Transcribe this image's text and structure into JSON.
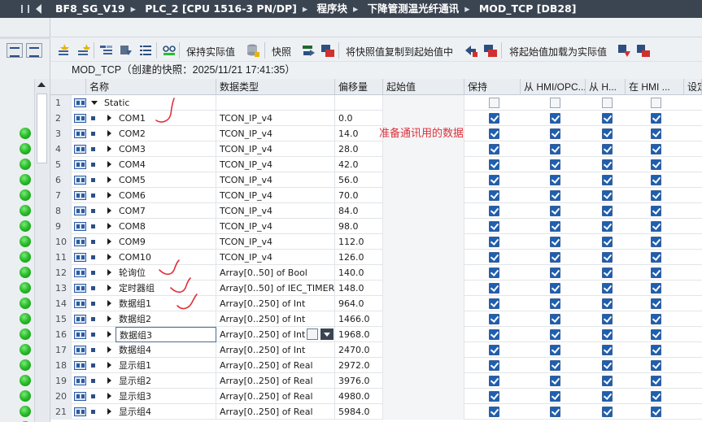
{
  "titlebar": {
    "crumbs": [
      "BF8_SG_V19",
      "PLC_2 [CPU 1516-3 PN/DP]",
      "程序块",
      "下降管测温光纤通讯",
      "MOD_TCP [DB28]"
    ],
    "separator": "▸"
  },
  "toolbar": {
    "keep_actual": "保持实际值",
    "snapshot": "快照",
    "copy_snapshot": "将快照值复制到起始值中",
    "load_start": "将起始值加载为实际值"
  },
  "snapshot_title": "MOD_TCP（创建的快照：2025/11/21 17:41:35）",
  "columns": {
    "name": "名称",
    "datatype": "数据类型",
    "offset": "偏移量",
    "start": "起始值",
    "retain": "保持",
    "from_hmi": "从 HMI/OPC...",
    "from_h": "从 H...",
    "in_hmi": "在 HMI ...",
    "setpoint": "设定"
  },
  "annotation": "准备通讯用的数据",
  "rows": [
    {
      "num": "1",
      "name": "Static",
      "type": "",
      "offset": "",
      "expanded": true
    },
    {
      "num": "2",
      "name": "COM1",
      "type": "TCON_IP_v4",
      "offset": "0.0"
    },
    {
      "num": "3",
      "name": "COM2",
      "type": "TCON_IP_v4",
      "offset": "14.0"
    },
    {
      "num": "4",
      "name": "COM3",
      "type": "TCON_IP_v4",
      "offset": "28.0"
    },
    {
      "num": "5",
      "name": "COM4",
      "type": "TCON_IP_v4",
      "offset": "42.0"
    },
    {
      "num": "6",
      "name": "COM5",
      "type": "TCON_IP_v4",
      "offset": "56.0"
    },
    {
      "num": "7",
      "name": "COM6",
      "type": "TCON_IP_v4",
      "offset": "70.0"
    },
    {
      "num": "8",
      "name": "COM7",
      "type": "TCON_IP_v4",
      "offset": "84.0"
    },
    {
      "num": "9",
      "name": "COM8",
      "type": "TCON_IP_v4",
      "offset": "98.0"
    },
    {
      "num": "10",
      "name": "COM9",
      "type": "TCON_IP_v4",
      "offset": "112.0"
    },
    {
      "num": "11",
      "name": "COM10",
      "type": "TCON_IP_v4",
      "offset": "126.0"
    },
    {
      "num": "12",
      "name": "轮询位",
      "type": "Array[0..50] of Bool",
      "offset": "140.0"
    },
    {
      "num": "13",
      "name": "定时器组",
      "type": "Array[0..50] of IEC_TIMER",
      "offset": "148.0"
    },
    {
      "num": "14",
      "name": "数据组1",
      "type": "Array[0..250] of Int",
      "offset": "964.0"
    },
    {
      "num": "15",
      "name": "数据组2",
      "type": "Array[0..250] of Int",
      "offset": "1466.0"
    },
    {
      "num": "16",
      "name": "数据组3",
      "type": "Array[0..250] of Int",
      "offset": "1968.0",
      "selected": true
    },
    {
      "num": "17",
      "name": "数据组4",
      "type": "Array[0..250] of Int",
      "offset": "2470.0"
    },
    {
      "num": "18",
      "name": "显示组1",
      "type": "Array[0..250] of Real",
      "offset": "2972.0"
    },
    {
      "num": "19",
      "name": "显示组2",
      "type": "Array[0..250] of Real",
      "offset": "3976.0"
    },
    {
      "num": "20",
      "name": "显示组3",
      "type": "Array[0..250] of Real",
      "offset": "4980.0"
    },
    {
      "num": "21",
      "name": "显示组4",
      "type": "Array[0..250] of Real",
      "offset": "5984.0"
    }
  ]
}
